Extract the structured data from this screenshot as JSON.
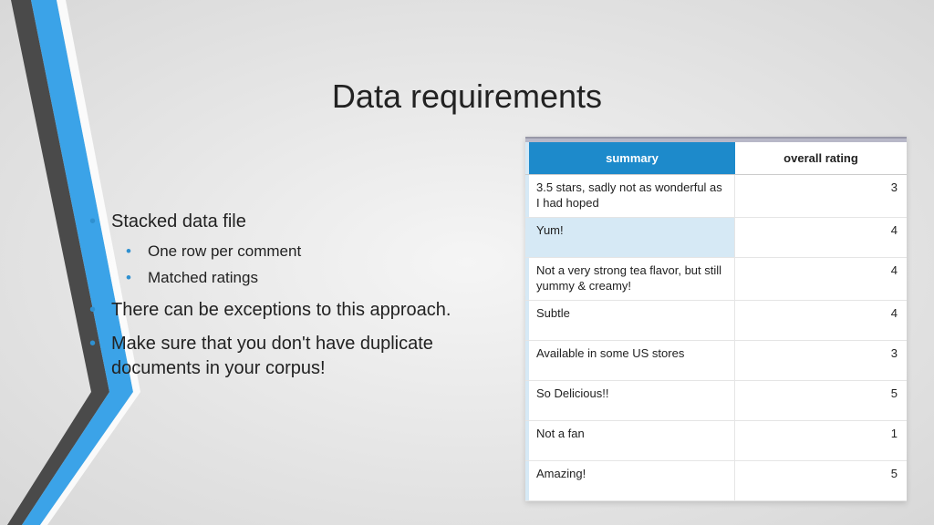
{
  "title": "Data requirements",
  "bullets": {
    "b1": "Stacked data file",
    "b1a": "One row per comment",
    "b1b": "Matched ratings",
    "b2": "There can be exceptions to this approach.",
    "b3": "Make sure that you don't have duplicate documents in your corpus!"
  },
  "table": {
    "headers": {
      "summary": "summary",
      "rating": "overall rating"
    },
    "rows": [
      {
        "summary": "3.5 stars,  sadly not as wonderful as I had hoped",
        "rating": "3",
        "selected": false
      },
      {
        "summary": "Yum!",
        "rating": "4",
        "selected": true
      },
      {
        "summary": "Not a very strong tea flavor, but still yummy & creamy!",
        "rating": "4",
        "selected": false
      },
      {
        "summary": "Subtle",
        "rating": "4",
        "selected": false
      },
      {
        "summary": "Available in some US stores",
        "rating": "3",
        "selected": false
      },
      {
        "summary": "So Delicious!!",
        "rating": "5",
        "selected": false
      },
      {
        "summary": "Not a fan",
        "rating": "1",
        "selected": false
      },
      {
        "summary": "Amazing!",
        "rating": "5",
        "selected": false
      }
    ]
  }
}
